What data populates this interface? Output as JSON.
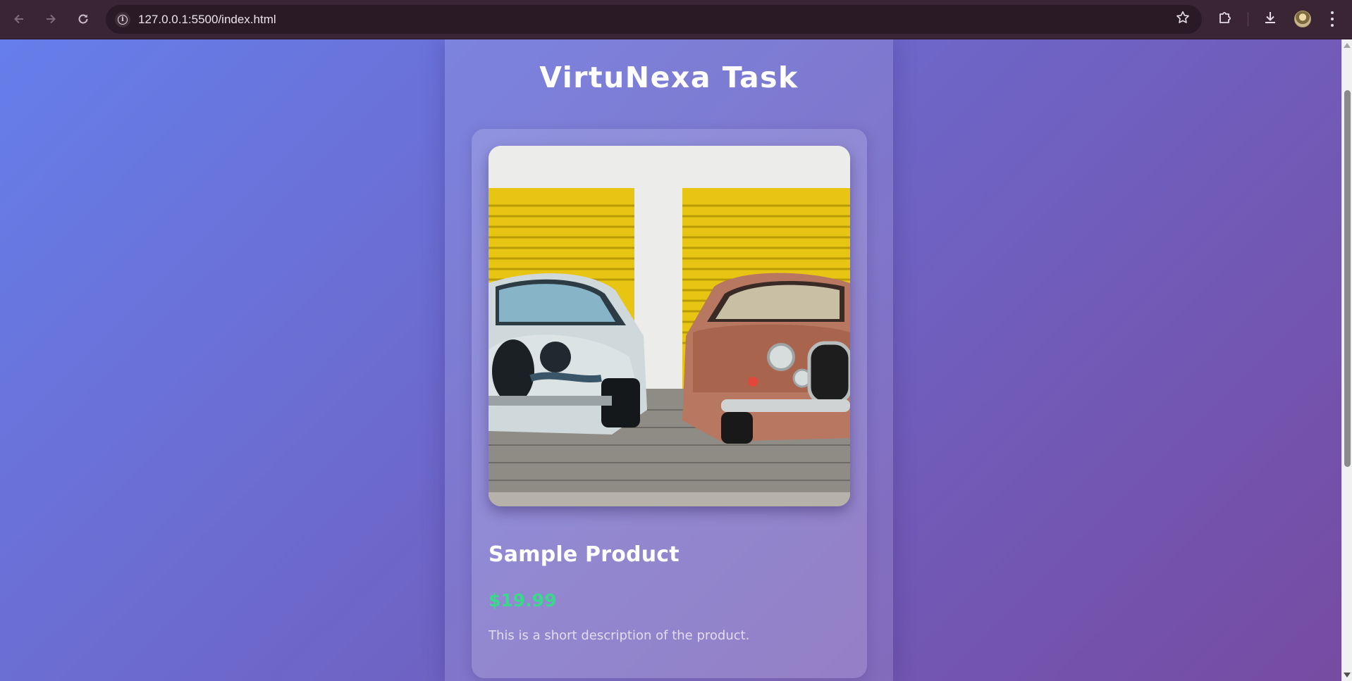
{
  "browser": {
    "url": "127.0.0.1:5500/index.html",
    "icons": [
      "back-icon",
      "forward-icon",
      "reload-icon",
      "site-info-icon",
      "bookmark-star-icon",
      "extensions-icon",
      "download-icon",
      "profile-avatar",
      "menu-icon"
    ]
  },
  "page": {
    "title": "VirtuNexa Task"
  },
  "product": {
    "name": "Sample Product",
    "price": "$19.99",
    "description": "This is a short description of the product.",
    "image_alt": "Two vintage cars parked in front of yellow garage doors"
  },
  "colors": {
    "background_start": "#667eea",
    "background_end": "#764ba2",
    "price": "#39d98a",
    "chrome": "#3a2535"
  }
}
